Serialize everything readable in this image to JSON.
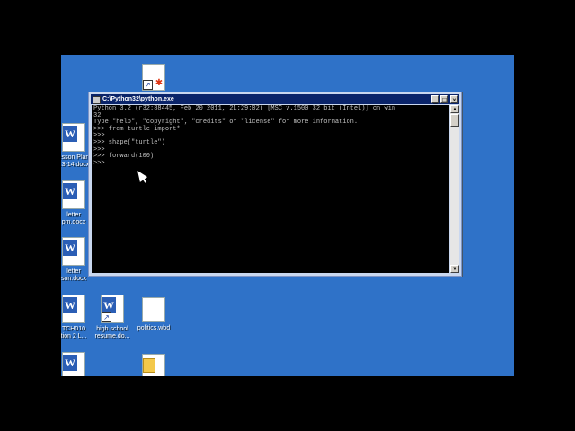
{
  "window": {
    "title": "C:\\Python32\\python.exe",
    "minimize_label": "_",
    "maximize_label": "□",
    "close_label": "×"
  },
  "console": {
    "lines": [
      "Python 3.2 (r32:88445, Feb 20 2011, 21:29:02) [MSC v.1500 32 bit (Intel)] on win",
      "32",
      "Type \"help\", \"copyright\", \"credits\" or \"license\" for more information.",
      ">>> from turtle import*",
      ">>>",
      ">>> shape(\"turtle\")",
      ">>>",
      ">>> forward(100)",
      ">>>"
    ]
  },
  "desktop": {
    "icons": [
      {
        "name": "desktop-icon-shortcut-pdf",
        "label": ""
      },
      {
        "name": "desktop-icon-lesson-plan",
        "label": "esson Plan\n13-14.docx"
      },
      {
        "name": "desktop-icon-letter-1",
        "label": "letter\npm.docx"
      },
      {
        "name": "desktop-icon-letter-2",
        "label": "letter\nson.docx"
      },
      {
        "name": "desktop-icon-tch010",
        "label": "TCH010\ntion 2 L..."
      },
      {
        "name": "desktop-icon-high-school-resume",
        "label": "high school\nresume.do..."
      },
      {
        "name": "desktop-icon-politics",
        "label": "politics.wbd"
      },
      {
        "name": "desktop-icon-word-doc",
        "label": ""
      },
      {
        "name": "desktop-icon-folder-doc",
        "label": ""
      }
    ]
  },
  "colors": {
    "desktop_bg": "#2f72c8",
    "titlebar_bg": "#0a246a",
    "console_bg": "#000000",
    "console_fg": "#c0c0c0"
  }
}
